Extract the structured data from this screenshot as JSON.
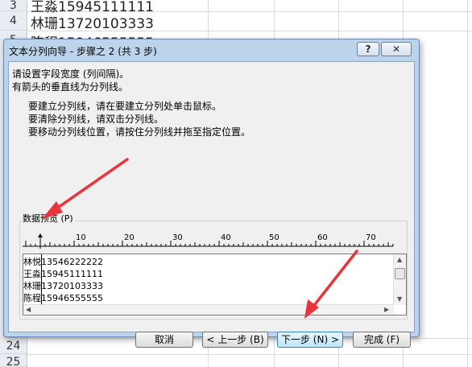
{
  "sheet": {
    "row_numbers": [
      "3",
      "4",
      "5",
      "24",
      "25"
    ],
    "cells": [
      "王淼15945111111",
      "林珊13720103333",
      "陈程15946555555"
    ]
  },
  "dialog": {
    "title": "文本分列向导 - 步骤之 2 (共 3 步)",
    "help_label": "?",
    "close_label": "✕",
    "intro_line1": "请设置字段宽度 (列间隔)。",
    "intro_line2": "有箭头的垂直线为分列线。",
    "instr_line1": "要建立分列线，请在要建立分列处单击鼠标。",
    "instr_line2": "要清除分列线，请双击分列线。",
    "instr_line3": "要移动分列线位置，请按住分列线并拖至指定位置。",
    "preview_label": "数据预览 (P)",
    "ruler_marks": [
      "10",
      "20",
      "30",
      "40",
      "50",
      "60",
      "70"
    ],
    "preview_rows": [
      "林悦13546222222",
      "王淼15945111111",
      "林珊13720103333",
      "陈程15946555555"
    ],
    "buttons": {
      "cancel": "取消",
      "back": "< 上一步 (B)",
      "next": "下一步 (N) >",
      "finish": "完成 (F)"
    }
  },
  "colors": {
    "dialog_frame": "#bcd3ec",
    "client_bg": "#f0f0f0",
    "annotation_arrow": "#e8343a"
  }
}
